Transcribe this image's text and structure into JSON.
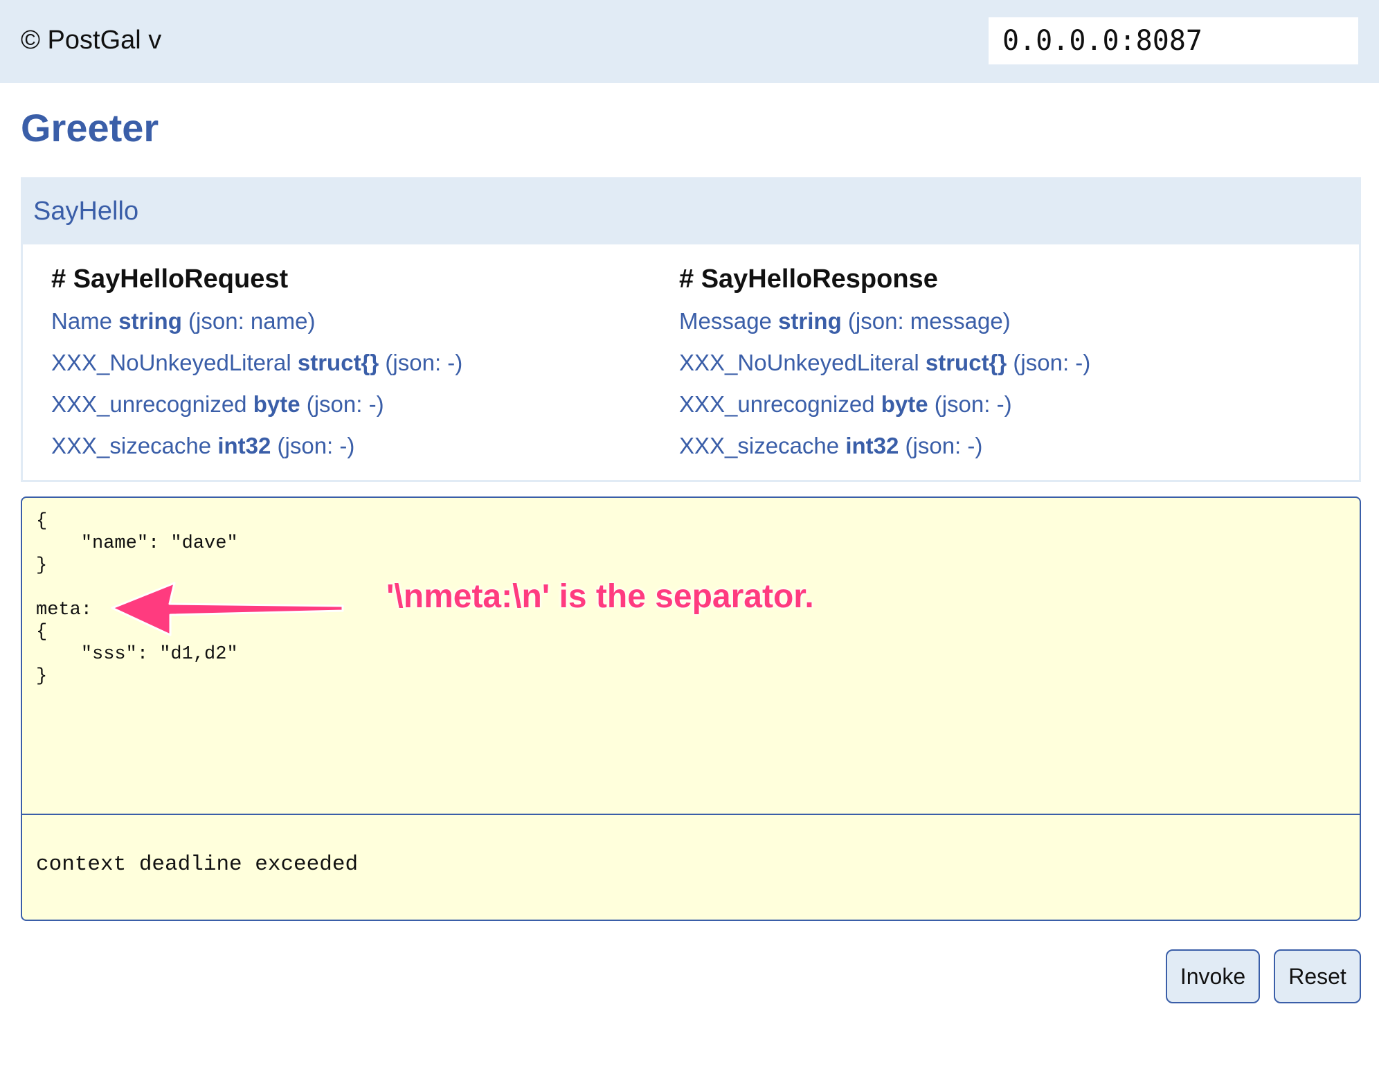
{
  "header": {
    "brand": "© PostGal v",
    "address_value": "0.0.0.0:8087"
  },
  "service": {
    "title": "Greeter"
  },
  "method": {
    "name": "SayHello",
    "request": {
      "title": "# SayHelloRequest",
      "fields": [
        {
          "name": "Name",
          "type": "string",
          "json": "(json: name)"
        },
        {
          "name": "XXX_NoUnkeyedLiteral",
          "type": "struct{}",
          "json": "(json: -)"
        },
        {
          "name": "XXX_unrecognized",
          "type": "byte",
          "json": "(json: -)"
        },
        {
          "name": "XXX_sizecache",
          "type": "int32",
          "json": "(json: -)"
        }
      ]
    },
    "response": {
      "title": "# SayHelloResponse",
      "fields": [
        {
          "name": "Message",
          "type": "string",
          "json": "(json: message)"
        },
        {
          "name": "XXX_NoUnkeyedLiteral",
          "type": "struct{}",
          "json": "(json: -)"
        },
        {
          "name": "XXX_unrecognized",
          "type": "byte",
          "json": "(json: -)"
        },
        {
          "name": "XXX_sizecache",
          "type": "int32",
          "json": "(json: -)"
        }
      ]
    }
  },
  "editor": {
    "request_text": "{\n    \"name\": \"dave\"\n}\n\nmeta:\n{\n    \"sss\": \"d1,d2\"\n}",
    "response_text": "context deadline exceeded"
  },
  "annotation": {
    "text": "'\\nmeta:\\n' is the separator.",
    "color": "#ff3b7f"
  },
  "buttons": {
    "invoke": "Invoke",
    "reset": "Reset"
  },
  "colors": {
    "accent": "#3a5ea8",
    "panel_bg": "#e1ebf5",
    "editor_bg": "#ffffdc"
  }
}
